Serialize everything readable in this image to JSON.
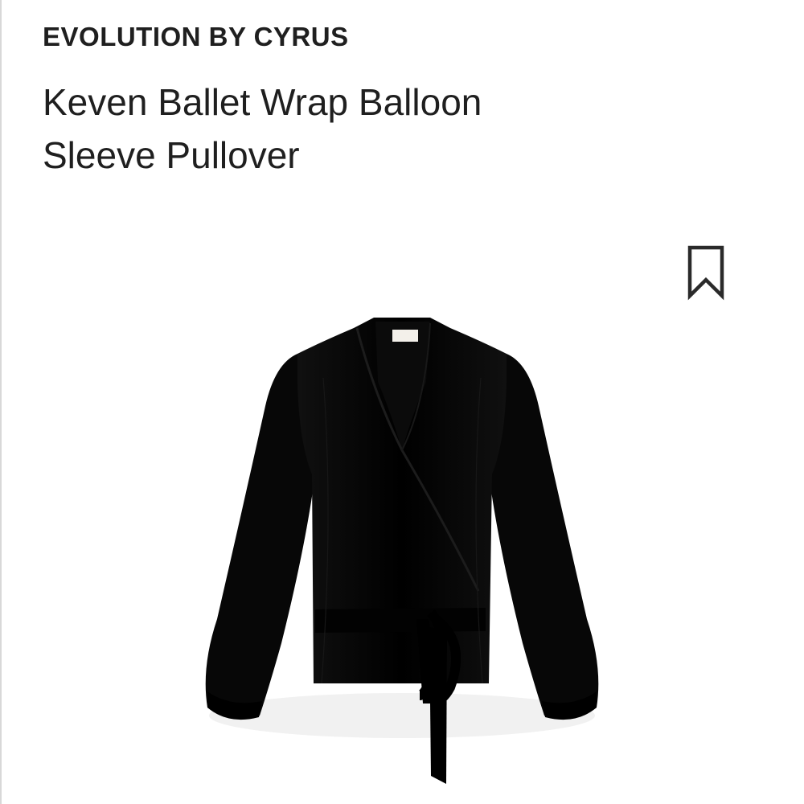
{
  "product": {
    "brand": "EVOLUTION BY CYRUS",
    "name_line_1": "Keven Ballet Wrap Balloon",
    "name_line_2": "Sleeve Pullover"
  },
  "icons": {
    "bookmark": "bookmark-icon",
    "product_image": "black-wrap-pullover-image"
  },
  "colors": {
    "text": "#1f1f1f",
    "garment": "#050505",
    "background": "#ffffff"
  }
}
